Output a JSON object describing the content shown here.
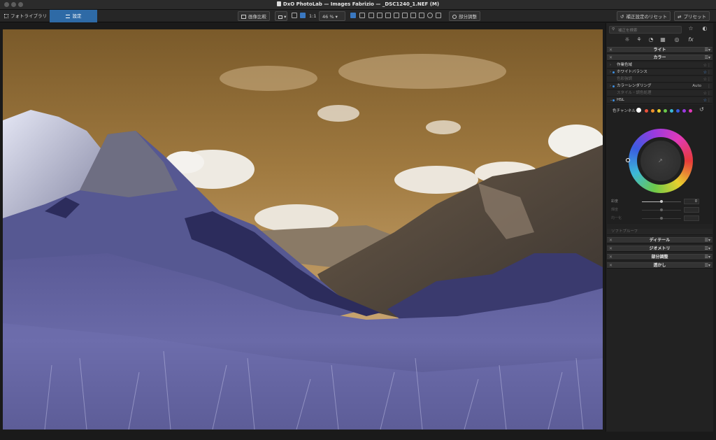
{
  "window": {
    "title": "DxO PhotoLab — Images Fabrizio — _DSC1240_1.NEF (M)"
  },
  "toolbar": {
    "photo_library_tab": "フォトライブラリ",
    "customize_tab": "設定",
    "compare_label": "画像比較",
    "zoom_1to1": "1:1",
    "zoom_level": "46 %",
    "local_adjust_label": "部分調整",
    "reset_label": "補正設定のリセット",
    "presets_label": "プリセット"
  },
  "panel": {
    "search_placeholder": "補正を検索",
    "sections": {
      "light": "ライト",
      "color": "カラー",
      "detail": "ディテール",
      "geometry": "ジオメトリ",
      "local": "部分調整",
      "watermark": "透かし"
    },
    "color_rows": {
      "working_space": "作業色域",
      "white_balance": "ホワイトバランス",
      "color_accentuation": "色彩強調",
      "color_rendering": "カラーレンダリング",
      "color_rendering_value": "Auto",
      "style_toning": "スタイル・調色処理",
      "hsl": "HSL"
    },
    "hsl": {
      "channel_label": "色チャンネル",
      "sliders": [
        {
          "label": "彩度",
          "value": "0"
        },
        {
          "label": "輝度",
          "value": ""
        },
        {
          "label": "均一化",
          "value": ""
        }
      ]
    },
    "softproof": "ソフトプルーフ"
  },
  "colors": {
    "accent": "#2e6aa6",
    "swatches": [
      "#ffffff",
      "#e8503a",
      "#f0922e",
      "#e8d02e",
      "#6cc94a",
      "#3cb8d8",
      "#3a5ce0",
      "#9a3ae0",
      "#e03ab8"
    ]
  }
}
